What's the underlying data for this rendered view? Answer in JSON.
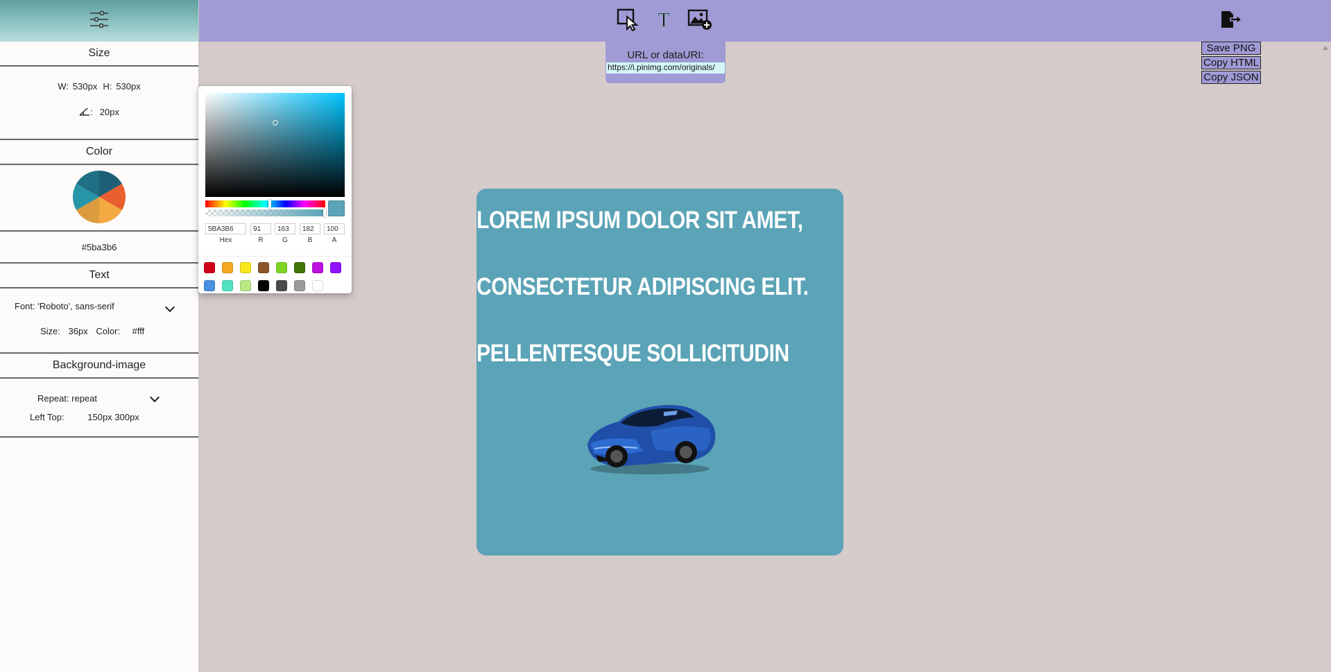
{
  "sidebar": {
    "size": {
      "title": "Size",
      "w_label": "W:",
      "w_value": "530px",
      "h_label": "H:",
      "h_value": "530px",
      "radius_label": ":",
      "radius_value": "20px"
    },
    "color": {
      "title": "Color",
      "hex_value": "#5ba3b6",
      "wheel_colors": [
        "#1e5f75",
        "#1f8a99",
        "#e95f2e",
        "#f4a941",
        "#dd9b3f",
        "#2795a8"
      ]
    },
    "text": {
      "title": "Text",
      "font_label": "Font:",
      "font_value": "'Roboto', sans-serif",
      "size_label": "Size:",
      "size_value": "36px",
      "color_label": "Color:",
      "color_value": "#fff"
    },
    "background_image": {
      "title": "Background-image",
      "repeat_label": "Repeat:",
      "repeat_value": "repeat",
      "left_top_label": "Left Top:",
      "left_top_value": "150px 300px"
    }
  },
  "toolbar": {
    "tools": [
      "select-tool",
      "text-tool",
      "add-image-tool"
    ],
    "export_icon": "export-icon"
  },
  "url_popup": {
    "label": "URL or dataURI:",
    "value": "https://i.pinimg.com/originals/"
  },
  "export_menu": {
    "save_png": "Save PNG",
    "copy_html": "Copy HTML",
    "copy_json": "Copy JSON"
  },
  "color_picker": {
    "hue_color": "#00c4ff",
    "current_color": "#5ba3b6",
    "hex": "5BA3B6",
    "r": "91",
    "g": "163",
    "b": "182",
    "a": "100",
    "hex_label": "Hex",
    "r_label": "R",
    "g_label": "G",
    "b_label": "B",
    "a_label": "A",
    "presets": [
      "#d0021b",
      "#f5a623",
      "#f8e71c",
      "#8b572a",
      "#7ed321",
      "#417505",
      "#bd10e0",
      "#9013fe",
      "#4a90e2",
      "#50e3c2",
      "#b8e986",
      "#000000",
      "#4a4a4a",
      "#9b9b9b",
      "#ffffff"
    ]
  },
  "canvas": {
    "background": "#5ba3b6",
    "lines": [
      "LOREM IPSUM DOLOR SIT AMET,",
      "CONSECTETUR ADIPISCING ELIT.",
      "PELLENTESQUE SOLLICITUDIN"
    ],
    "image_subject": "blue-sports-car"
  }
}
